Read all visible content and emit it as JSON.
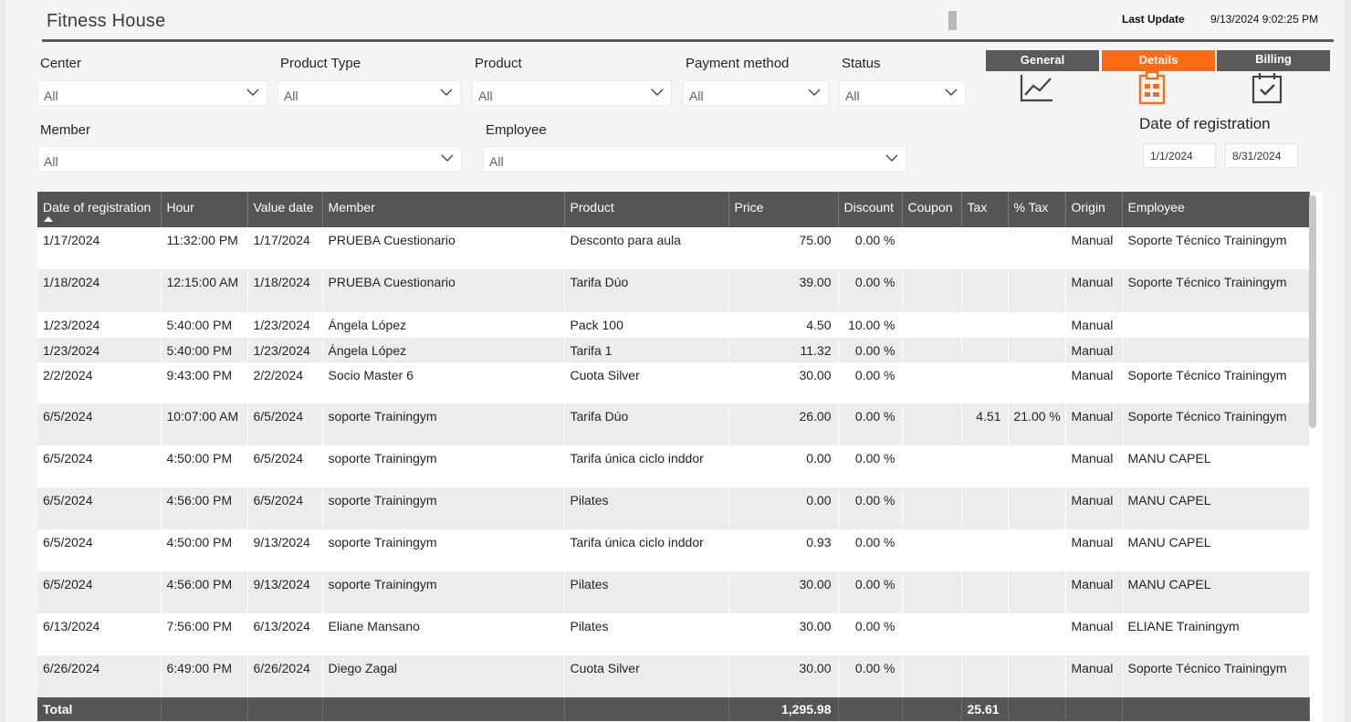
{
  "header": {
    "title": "Fitness House",
    "last_update_label": "Last Update",
    "last_update_value": "9/13/2024 9:02:25 PM"
  },
  "filters": {
    "center": {
      "label": "Center",
      "value": "All"
    },
    "product_type": {
      "label": "Product Type",
      "value": "All"
    },
    "product": {
      "label": "Product",
      "value": "All"
    },
    "payment_method": {
      "label": "Payment method",
      "value": "All"
    },
    "status": {
      "label": "Status",
      "value": "All"
    },
    "member": {
      "label": "Member",
      "value": "All"
    },
    "employee": {
      "label": "Employee",
      "value": "All"
    }
  },
  "nav_tabs": {
    "general": {
      "label": "General",
      "icon": "line-chart-icon"
    },
    "details": {
      "label": "Details",
      "icon": "clipboard-icon",
      "active": true
    },
    "billing": {
      "label": "Billing",
      "icon": "calendar-check-icon"
    }
  },
  "date_filter": {
    "title": "Date of registration",
    "start": "1/1/2024",
    "end": "8/31/2024"
  },
  "table": {
    "columns": [
      "Date of registration",
      "Hour",
      "Value date",
      "Member",
      "Product",
      "Price",
      "Discount",
      "Coupon",
      "Tax",
      "% Tax",
      "Origin",
      "Employee"
    ],
    "sort": {
      "column": "Date of registration",
      "direction": "ascending"
    },
    "rows": [
      [
        "1/17/2024",
        "11:32:00 PM",
        "1/17/2024",
        "PRUEBA Cuestionario",
        "Desconto para aula",
        "75.00",
        "0.00 %",
        "",
        "",
        "",
        "Manual",
        "Soporte Técnico Trainingym"
      ],
      [
        "1/18/2024",
        "12:15:00 AM",
        "1/18/2024",
        "PRUEBA Cuestionario",
        "Tarifa Dúo",
        "39.00",
        "0.00 %",
        "",
        "",
        "",
        "Manual",
        "Soporte Técnico Trainingym"
      ],
      [
        "1/23/2024",
        "5:40:00 PM",
        "1/23/2024",
        "Ángela López",
        "Pack 100",
        "4.50",
        "10.00 %",
        "",
        "",
        "",
        "Manual",
        ""
      ],
      [
        "1/23/2024",
        "5:40:00 PM",
        "1/23/2024",
        "Ángela López",
        "Tarifa 1",
        "11.32",
        "0.00 %",
        "",
        "",
        "",
        "Manual",
        ""
      ],
      [
        "2/2/2024",
        "9:43:00 PM",
        "2/2/2024",
        "Socio Master 6",
        "Cuota Silver",
        "30.00",
        "0.00 %",
        "",
        "",
        "",
        "Manual",
        "Soporte Técnico Trainingym"
      ],
      [
        "6/5/2024",
        "10:07:00 AM",
        "6/5/2024",
        "soporte Trainingym",
        "Tarifa Dúo",
        "26.00",
        "0.00 %",
        "",
        "4.51",
        "21.00 %",
        "Manual",
        "Soporte Técnico Trainingym"
      ],
      [
        "6/5/2024",
        "4:50:00 PM",
        "6/5/2024",
        "soporte Trainingym",
        "Tarifa única ciclo inddor",
        "0.00",
        "0.00 %",
        "",
        "",
        "",
        "Manual",
        "MANU CAPEL"
      ],
      [
        "6/5/2024",
        "4:56:00 PM",
        "6/5/2024",
        "soporte Trainingym",
        "Pilates",
        "0.00",
        "0.00 %",
        "",
        "",
        "",
        "Manual",
        "MANU CAPEL"
      ],
      [
        "6/5/2024",
        "4:50:00 PM",
        "9/13/2024",
        "soporte Trainingym",
        "Tarifa única ciclo inddor",
        "0.93",
        "0.00 %",
        "",
        "",
        "",
        "Manual",
        "MANU CAPEL"
      ],
      [
        "6/5/2024",
        "4:56:00 PM",
        "9/13/2024",
        "soporte Trainingym",
        "Pilates",
        "30.00",
        "0.00 %",
        "",
        "",
        "",
        "Manual",
        "MANU CAPEL"
      ],
      [
        "6/13/2024",
        "7:56:00 PM",
        "6/13/2024",
        "Eliane Mansano",
        "Pilates",
        "30.00",
        "0.00 %",
        "",
        "",
        "",
        "Manual",
        "ELIANE Trainingym"
      ],
      [
        "6/26/2024",
        "6:49:00 PM",
        "6/26/2024",
        "Diego Zagal",
        "Cuota Silver",
        "30.00",
        "0.00 %",
        "",
        "",
        "",
        "Manual",
        "Soporte Técnico Trainingym"
      ]
    ],
    "total": {
      "label": "Total",
      "price": "1,295.98",
      "tax": "25.61"
    }
  },
  "colors": {
    "accent": "#ff6a13",
    "header_bg": "#555555",
    "alt_row": "#ececec"
  }
}
